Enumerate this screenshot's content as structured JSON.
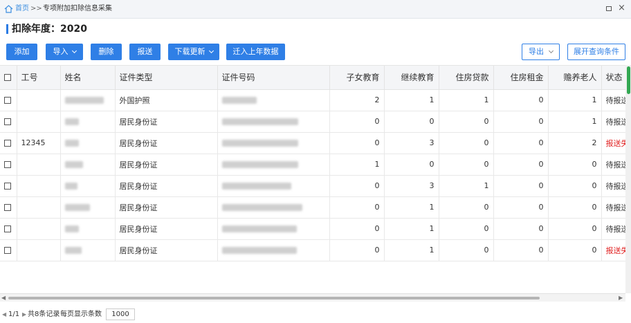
{
  "breadcrumb": {
    "home": "首页",
    "sep": ">>",
    "current": "专项附加扣除信息采集"
  },
  "window": {
    "restore_glyph": "□",
    "close_glyph": "×"
  },
  "page_title": "扣除年度：2020",
  "toolbar": {
    "add": "添加",
    "import": "导入",
    "delete": "删除",
    "submit": "报送",
    "download": "下载更新",
    "migrate": "迁入上年数据",
    "export": "导出",
    "expand_query": "展开查询条件"
  },
  "table": {
    "columns": [
      "工号",
      "姓名",
      "证件类型",
      "证件号码",
      "子女教育",
      "继续教育",
      "住房贷款",
      "住房租金",
      "赡养老人",
      "状态"
    ],
    "rows": [
      {
        "id": "",
        "id_type": "外国护照",
        "child": "2",
        "cont": "1",
        "loan": "1",
        "rent": "0",
        "elder": "1",
        "status": "待报送",
        "status_type": "pending"
      },
      {
        "id": "",
        "id_type": "居民身份证",
        "child": "0",
        "cont": "0",
        "loan": "0",
        "rent": "0",
        "elder": "1",
        "status": "待报送",
        "status_type": "pending"
      },
      {
        "id": "12345",
        "id_type": "居民身份证",
        "child": "0",
        "cont": "3",
        "loan": "0",
        "rent": "0",
        "elder": "2",
        "status": "报送失败",
        "status_type": "fail"
      },
      {
        "id": "",
        "id_type": "居民身份证",
        "child": "1",
        "cont": "0",
        "loan": "0",
        "rent": "0",
        "elder": "0",
        "status": "待报送",
        "status_type": "pending"
      },
      {
        "id": "",
        "id_type": "居民身份证",
        "child": "0",
        "cont": "3",
        "loan": "1",
        "rent": "0",
        "elder": "0",
        "status": "待报送",
        "status_type": "pending"
      },
      {
        "id": "",
        "id_type": "居民身份证",
        "child": "0",
        "cont": "1",
        "loan": "0",
        "rent": "0",
        "elder": "0",
        "status": "待报送",
        "status_type": "pending"
      },
      {
        "id": "",
        "id_type": "居民身份证",
        "child": "0",
        "cont": "1",
        "loan": "0",
        "rent": "0",
        "elder": "0",
        "status": "待报送",
        "status_type": "pending"
      },
      {
        "id": "",
        "id_type": "居民身份证",
        "child": "0",
        "cont": "1",
        "loan": "0",
        "rent": "0",
        "elder": "0",
        "status": "报送失败",
        "status_type": "fail"
      }
    ]
  },
  "pager": {
    "prev": "◀",
    "position": "1/1",
    "next": "▶",
    "total": "共8条记录",
    "per_page_label": "每页显示条数",
    "per_page": "1000"
  },
  "colors": {
    "accent": "#2f7fe6",
    "error": "#e02020",
    "scroll_thumb": "#32a852"
  }
}
